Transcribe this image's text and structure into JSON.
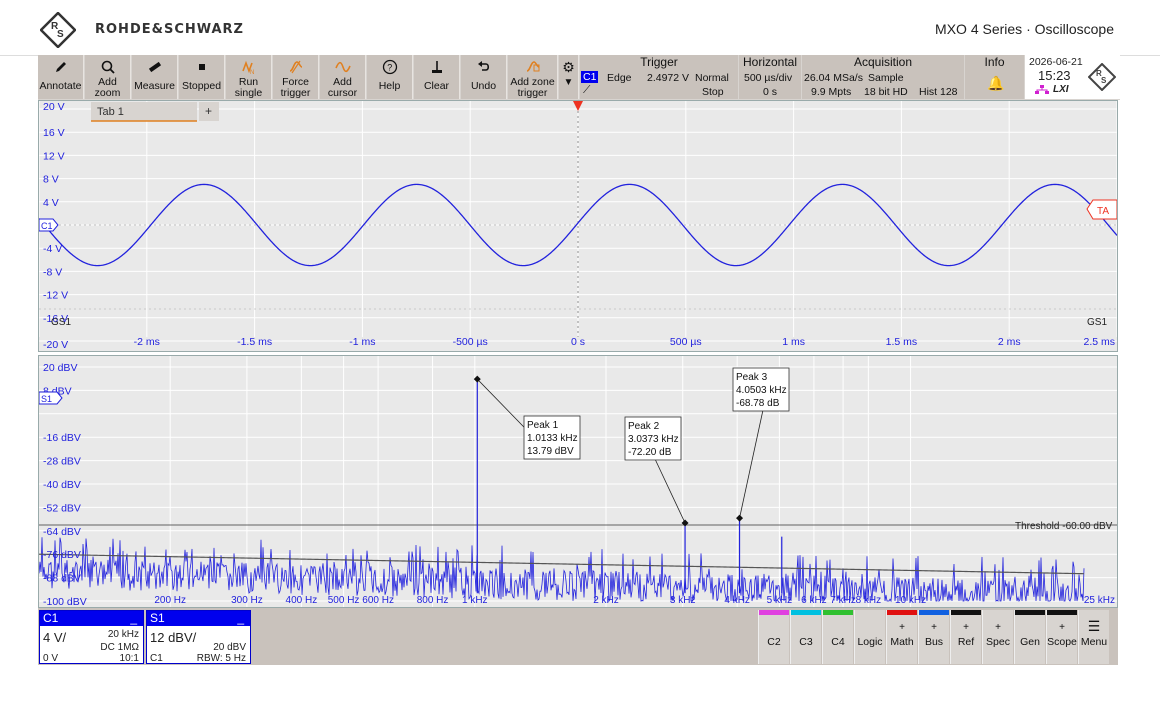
{
  "header": {
    "brand": "ROHDE&SCHWARZ",
    "window_title": "MXO 4 Series · Oscilloscope"
  },
  "toolbar": {
    "buttons": [
      {
        "label": "Annotate",
        "icon": "pen-icon"
      },
      {
        "label": "Add\nzoom",
        "icon": "magnifier-icon"
      },
      {
        "label": "Measure",
        "icon": "ruler-icon"
      },
      {
        "label": "Stopped",
        "icon": "stop-square-icon"
      },
      {
        "label": "Run\nsingle",
        "icon": "run-single-icon"
      },
      {
        "label": "Force\ntrigger",
        "icon": "force-trigger-icon"
      },
      {
        "label": "Add\ncursor",
        "icon": "cursor-wave-icon"
      },
      {
        "label": "Help",
        "icon": "help-icon"
      },
      {
        "label": "Clear",
        "icon": "clear-icon"
      },
      {
        "label": "Undo",
        "icon": "undo-arrow-icon"
      },
      {
        "label": "Add zone\ntrigger",
        "icon": "zone-trigger-icon"
      }
    ],
    "trigger": {
      "title": "Trigger",
      "channel": "C1",
      "type": "Edge",
      "level": "2.4972 V",
      "mode": "Normal",
      "state": "Stop"
    },
    "horizontal": {
      "title": "Horizontal",
      "scale": "500 µs/div",
      "position": "0 s"
    },
    "acquisition": {
      "title": "Acquisition",
      "sample_rate": "26.04 MSa/s",
      "mode": "Sample",
      "record_length": "9.9 Mpts",
      "resolution": "18 bit HD",
      "history": "Hist 128"
    },
    "info": {
      "title": "Info"
    },
    "date": "2026-06-21",
    "time": "15:23",
    "lxi": "LXI"
  },
  "tabs": [
    {
      "label": "Tab 1"
    }
  ],
  "tab_add": "+",
  "wave_diagram": {
    "y_labels": [
      "20 V",
      "16 V",
      "12 V",
      "8 V",
      "4 V",
      "-4 V",
      "-8 V",
      "-12 V",
      "-16 V",
      "-20 V"
    ],
    "x_labels": [
      "-2 ms",
      "-1.5 ms",
      "-1 ms",
      "-500 µs",
      "0 s",
      "500 µs",
      "1 ms",
      "1.5 ms",
      "2 ms",
      "2.5 ms"
    ],
    "channel_marker": "C1",
    "trigger_label": "TA",
    "gate_left": "GS1",
    "gate_right": "GS1",
    "amplitude_v": 7,
    "frequency_hz": 1013.3,
    "x_range_ms": [
      -2.5,
      2.5
    ],
    "y_range_v": [
      -20,
      20
    ]
  },
  "spectrum": {
    "y_labels": [
      "20 dBV",
      "8 dBV",
      "-16 dBV",
      "-28 dBV",
      "-40 dBV",
      "-52 dBV",
      "-64 dBV",
      "-76 dBV",
      "-88 dBV",
      "-100 dBV"
    ],
    "x_labels": [
      "200 Hz",
      "300 Hz",
      "400 Hz",
      "500 Hz",
      "600 Hz",
      "800 Hz",
      "1 kHz",
      "2 kHz",
      "3 kHz",
      "4 kHz",
      "5 kHz",
      "6 kHz",
      "7 kHz",
      "8 kHz",
      "10 kHz",
      "25 kHz"
    ],
    "spectrum_marker": "S1",
    "threshold_label": "Threshold -60.00 dBV",
    "peaks": [
      {
        "title": "Peak 1",
        "freq": "1.0133 kHz",
        "level": "13.79 dBV",
        "freq_hz": 1013.3,
        "level_db": 13.79
      },
      {
        "title": "Peak 2",
        "freq": "3.0373 kHz",
        "level": "-72.20 dB",
        "freq_hz": 3037.3,
        "level_db": -60
      },
      {
        "title": "Peak 3",
        "freq": "4.0503 kHz",
        "level": "-68.78 dB",
        "freq_hz": 4050.3,
        "level_db": -57.5
      }
    ]
  },
  "bottom": {
    "c1": {
      "name": "C1",
      "scale": "4 V/",
      "bandwidth": "20 kHz",
      "coupling": "DC 1MΩ",
      "offset": "0 V",
      "probe": "10:1"
    },
    "s1": {
      "name": "S1",
      "scale": "12 dBV/",
      "ref": "20 dBV",
      "source": "C1",
      "rbw": "RBW: 5 Hz"
    },
    "buttons": [
      {
        "label": "C2",
        "plus": "",
        "color": "#e040e0"
      },
      {
        "label": "C3",
        "plus": "",
        "color": "#00c0e0"
      },
      {
        "label": "C4",
        "plus": "",
        "color": "#30c030"
      },
      {
        "label": "Logic",
        "plus": "",
        "color": ""
      },
      {
        "label": "Math",
        "plus": "+",
        "color": "#e01010"
      },
      {
        "label": "Bus",
        "plus": "+",
        "color": "#1060e0"
      },
      {
        "label": "Ref",
        "plus": "+",
        "color": "#111111"
      },
      {
        "label": "Spec",
        "plus": "+",
        "color": ""
      },
      {
        "label": "Gen",
        "plus": "",
        "color": "#111111"
      },
      {
        "label": "Scope",
        "plus": "+",
        "color": "#111111"
      },
      {
        "label": "Menu",
        "plus": "",
        "color": ""
      }
    ]
  },
  "colors": {
    "trace": "#2222dd",
    "toolbar_bg": "#c9c2bc",
    "grid_bg": "#e9e9e9"
  }
}
